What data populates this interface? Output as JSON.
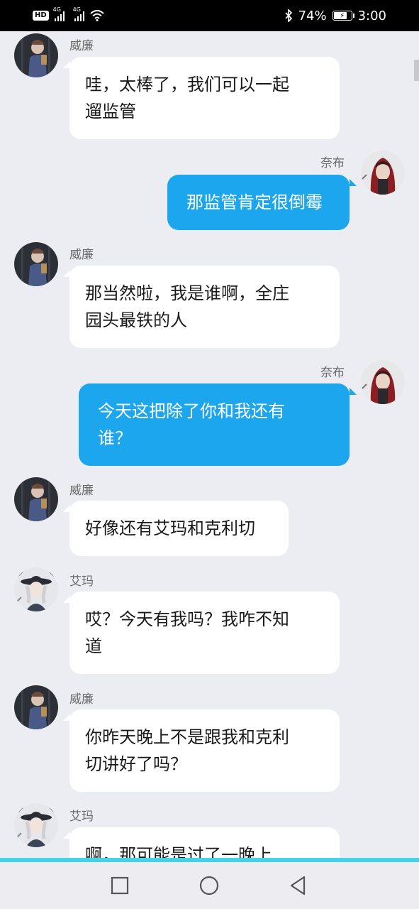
{
  "status_bar": {
    "hd_label": "HD",
    "sim1_label": "4G",
    "sim2_label": "4G",
    "battery_percent": "74%",
    "time": "3:00",
    "bluetooth_icon": "bluetooth-icon",
    "wifi_icon": "wifi-icon"
  },
  "colors": {
    "background": "#ebedf2",
    "own_bubble": "#1ba6ee",
    "other_bubble": "#ffffff",
    "nav_accent": "#45d4e6"
  },
  "messages": [
    {
      "sender": "威廉",
      "side": "left",
      "avatar": "william-avatar",
      "lines": [
        "哇，太棒了，我们可以一起",
        "遛监管"
      ]
    },
    {
      "sender": "奈布",
      "side": "right",
      "avatar": "naib-avatar",
      "lines": [
        "那监管肯定很倒霉"
      ]
    },
    {
      "sender": "威廉",
      "side": "left",
      "avatar": "william-avatar",
      "lines": [
        "那当然啦，我是谁啊，全庄",
        "园头最铁的人"
      ]
    },
    {
      "sender": "奈布",
      "side": "right",
      "avatar": "naib-avatar",
      "lines": [
        "今天这把除了你和我还有",
        "谁？"
      ]
    },
    {
      "sender": "威廉",
      "side": "left",
      "avatar": "william-avatar",
      "lines": [
        "好像还有艾玛和克利切"
      ]
    },
    {
      "sender": "艾玛",
      "side": "left",
      "avatar": "emma-avatar",
      "lines": [
        "哎？今天有我吗？我咋不知",
        "道"
      ]
    },
    {
      "sender": "威廉",
      "side": "left",
      "avatar": "william-avatar",
      "lines": [
        "你昨天晚上不是跟我和克利",
        "切讲好了吗？"
      ]
    },
    {
      "sender": "艾玛",
      "side": "left",
      "avatar": "emma-avatar",
      "lines": [
        "啊，那可能是过了一晚上"
      ]
    }
  ],
  "nav": {
    "recents_icon": "square-recents-icon",
    "home_icon": "circle-home-icon",
    "back_icon": "triangle-back-icon"
  }
}
